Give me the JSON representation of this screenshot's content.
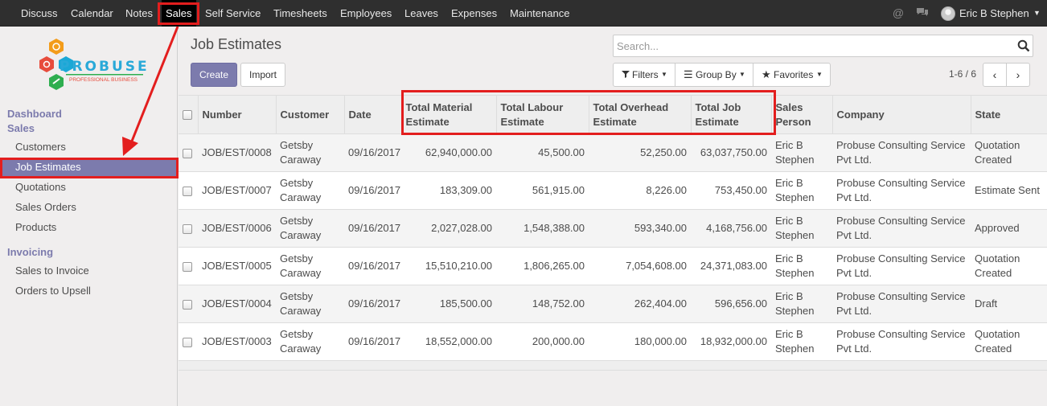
{
  "topbar": {
    "menu": [
      "Discuss",
      "Calendar",
      "Notes",
      "Sales",
      "Self Service",
      "Timesheets",
      "Employees",
      "Leaves",
      "Expenses",
      "Maintenance"
    ],
    "user_name": "Eric B Stephen",
    "icons": [
      "at-icon",
      "chat-icon",
      "avatar",
      "caret-down-icon"
    ]
  },
  "sidebar": {
    "logo": {
      "name": "PROBUSE",
      "tagline": "PROFESSIONAL BUSINESS"
    },
    "sections": [
      {
        "label": "Dashboard"
      },
      {
        "label": "Sales",
        "items": [
          "Customers",
          "Job Estimates",
          "Quotations",
          "Sales Orders",
          "Products"
        ]
      },
      {
        "label": "Invoicing",
        "items": [
          "Sales to Invoice",
          "Orders to Upsell"
        ]
      }
    ],
    "active_item": "Job Estimates"
  },
  "control_panel": {
    "breadcrumb": "Job Estimates",
    "create_label": "Create",
    "import_label": "Import",
    "search_placeholder": "Search...",
    "filters_label": "Filters",
    "groupby_label": "Group By",
    "favorites_label": "Favorites",
    "pager": "1-6 / 6"
  },
  "table": {
    "headers": [
      "Number",
      "Customer",
      "Date",
      "Total Material Estimate",
      "Total Labour Estimate",
      "Total Overhead Estimate",
      "Total Job Estimate",
      "Sales Person",
      "Company",
      "State"
    ],
    "rows": [
      [
        "JOB/EST/0008",
        "Getsby Caraway",
        "09/16/2017",
        "62,940,000.00",
        "45,500.00",
        "52,250.00",
        "63,037,750.00",
        "Eric B Stephen",
        "Probuse Consulting Service Pvt Ltd.",
        "Quotation Created"
      ],
      [
        "JOB/EST/0007",
        "Getsby Caraway",
        "09/16/2017",
        "183,309.00",
        "561,915.00",
        "8,226.00",
        "753,450.00",
        "Eric B Stephen",
        "Probuse Consulting Service Pvt Ltd.",
        "Estimate Sent"
      ],
      [
        "JOB/EST/0006",
        "Getsby Caraway",
        "09/16/2017",
        "2,027,028.00",
        "1,548,388.00",
        "593,340.00",
        "4,168,756.00",
        "Eric B Stephen",
        "Probuse Consulting Service Pvt Ltd.",
        "Approved"
      ],
      [
        "JOB/EST/0005",
        "Getsby Caraway",
        "09/16/2017",
        "15,510,210.00",
        "1,806,265.00",
        "7,054,608.00",
        "24,371,083.00",
        "Eric B Stephen",
        "Probuse Consulting Service Pvt Ltd.",
        "Quotation Created"
      ],
      [
        "JOB/EST/0004",
        "Getsby Caraway",
        "09/16/2017",
        "185,500.00",
        "148,752.00",
        "262,404.00",
        "596,656.00",
        "Eric B Stephen",
        "Probuse Consulting Service Pvt Ltd.",
        "Draft"
      ],
      [
        "JOB/EST/0003",
        "Getsby Caraway",
        "09/16/2017",
        "18,552,000.00",
        "200,000.00",
        "180,000.00",
        "18,932,000.00",
        "Eric B Stephen",
        "Probuse Consulting Service Pvt Ltd.",
        "Quotation Created"
      ]
    ]
  },
  "colors": {
    "accent": "#7c7bad",
    "annotation": "#e31e1e",
    "topbar": "#2f2f2f"
  }
}
